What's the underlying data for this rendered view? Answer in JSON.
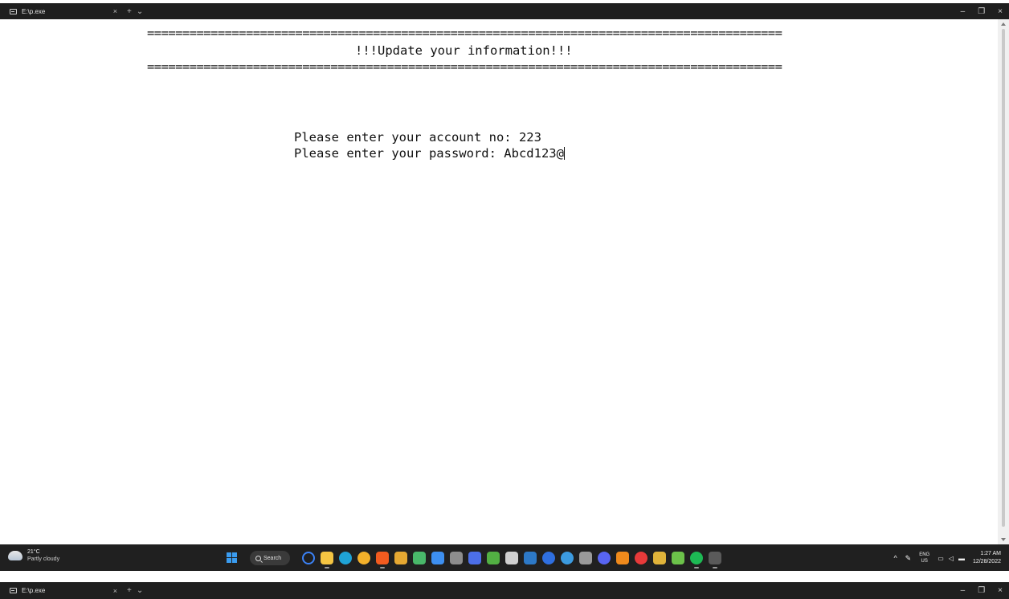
{
  "window": {
    "tab_title": "E:\\p.exe",
    "tab_close": "×",
    "new_tab": "+",
    "tab_menu": "⌄",
    "minimize": "–",
    "maximize": "❐",
    "close": "×"
  },
  "console": {
    "rule_top": "==========================================================================================",
    "heading": "!!!Update your information!!!",
    "rule_bottom": "==========================================================================================",
    "prompt_account": "Please enter your account no: 223",
    "prompt_password": "Please enter your password: Abcd123@"
  },
  "taskbar": {
    "weather_temp": "21°C",
    "weather_condition": "Partly cloudy",
    "search_label": "Search",
    "apps": [
      {
        "name": "cortana-icon",
        "color": "#3b82f6"
      },
      {
        "name": "file-explorer-icon",
        "color": "#f5c542"
      },
      {
        "name": "edge-icon",
        "color": "#1fa3d6"
      },
      {
        "name": "chrome-icon",
        "color": "#f3b02a"
      },
      {
        "name": "brave-icon",
        "color": "#f35b1f"
      },
      {
        "name": "app-icon-ribbon",
        "color": "#e6a832"
      },
      {
        "name": "app-icon-leaf",
        "color": "#49b86a"
      },
      {
        "name": "store-icon",
        "color": "#3d8ff0"
      },
      {
        "name": "app-icon-hex",
        "color": "#8d8d8d"
      },
      {
        "name": "app-icon-blue-square",
        "color": "#4c6fe8"
      },
      {
        "name": "xbox-icon",
        "color": "#52b043"
      },
      {
        "name": "app-icon-g",
        "color": "#d0d0d0"
      },
      {
        "name": "lightroom-icon",
        "color": "#2d79c7"
      },
      {
        "name": "app-icon-bluedot",
        "color": "#2f6fe0"
      },
      {
        "name": "app-icon-globe",
        "color": "#3c9be0"
      },
      {
        "name": "app-icon-calc",
        "color": "#9a9a9a"
      },
      {
        "name": "discord-icon",
        "color": "#5865f2"
      },
      {
        "name": "vlc-icon",
        "color": "#f08a1c"
      },
      {
        "name": "app-icon-red",
        "color": "#e83a3a"
      },
      {
        "name": "app-icon-diamond",
        "color": "#e0b33a"
      },
      {
        "name": "app-icon-green-blocks",
        "color": "#6cc24a"
      },
      {
        "name": "spotify-icon",
        "color": "#1db954"
      },
      {
        "name": "terminal-icon",
        "color": "#5a5a5a"
      }
    ],
    "tray_chevron": "^",
    "language_top": "ENG",
    "language_bottom": "US",
    "time": "1:27 AM",
    "date": "12/28/2022"
  },
  "colors": {
    "titlebar_bg": "#1f1f1f",
    "console_bg": "#ffffff",
    "console_text": "#111111",
    "taskbar_bg": "#202020"
  }
}
